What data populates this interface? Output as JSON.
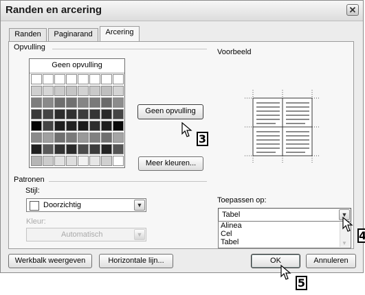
{
  "window": {
    "title": "Randen en arcering",
    "close_label": "✕"
  },
  "tabs": [
    {
      "label": "Randen",
      "key": "R"
    },
    {
      "label": "Paginarand",
      "key": "P"
    },
    {
      "label": "Arcering",
      "key": "c"
    }
  ],
  "fill": {
    "group_label": "Opvulling",
    "palette_no_fill": "Geen opvulling",
    "selected_label": "Geen opvulling",
    "more_colors_button": "Meer kleuren..."
  },
  "preview": {
    "label": "Voorbeeld"
  },
  "patterns": {
    "group_label": "Patronen",
    "style_label": "Stijl:",
    "style_value": "Doorzichtig",
    "color_label": "Kleur:",
    "color_value": "Automatisch"
  },
  "apply": {
    "label": "Toepassen op:",
    "value": "Tabel",
    "options": [
      "Alinea",
      "Cel",
      "Tabel"
    ]
  },
  "buttons": {
    "toolbar": "Werkbalk weergeven",
    "horizontal_line": "Horizontale lijn...",
    "ok": "OK",
    "cancel": "Annuleren"
  },
  "badges": {
    "step3": "3",
    "step4": "4",
    "step5": "5"
  },
  "colors": {
    "dialog_bg": "#ececec",
    "panel_bg": "#f7f7f7",
    "selected_outline": "#000000"
  }
}
